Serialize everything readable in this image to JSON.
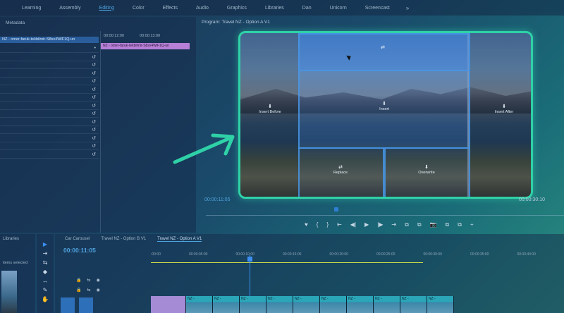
{
  "workspace_tabs": [
    "Learning",
    "Assembly",
    "Editing",
    "Color",
    "Effects",
    "Audio",
    "Graphics",
    "Libraries",
    "Dan",
    "Unicorn",
    "Screencast"
  ],
  "active_tab": "Editing",
  "more_glyph": "»",
  "metadata": {
    "title": "Metadata",
    "selected_row": "NZ - omer-faruk-tekbilmir-S8sx4WlF1Q-un",
    "clip_label": "NZ - omer-faruk-tekbilmir-S8sx4WlF1Q-un",
    "ruler": [
      "00:00:12:00",
      "00:00:13:00"
    ]
  },
  "program": {
    "title": "Program: Travel NZ - Option A V1",
    "overlay_labels": {
      "insert_before": "Insert Before",
      "insert": "Insert",
      "insert_after": "Insert After",
      "replace": "Replace",
      "overwrite": "Overwrite"
    },
    "timecode_left": "00:00:11:05",
    "timecode_right": "00:00:30:10",
    "transport": [
      "♥",
      "{",
      "}",
      "⇤",
      "◀|",
      "▶",
      "|▶",
      "⇥",
      "⧉",
      "⧉",
      "📷",
      "⧉",
      "⧉",
      "+"
    ]
  },
  "libraries": {
    "title": "Libraries",
    "status": "items selected"
  },
  "tools": [
    "▶",
    "⇥",
    "⇆",
    "◆",
    "↔",
    "✎",
    "✋"
  ],
  "sequence": {
    "tabs": [
      "Car Carousel",
      "Travel NZ - Option B V1",
      "Travel NZ - Option A V1"
    ],
    "active_tab": "Travel NZ - Option A V1",
    "timecode": "00:00:11:05",
    "ruler": [
      ":00:00",
      "00:00:05:00",
      "00:00:10:00",
      "00:00:15:00",
      "00:00:20:00",
      "00:00:25:00",
      "00:00:30:00",
      "00:00:35:00",
      "00:00:40:00"
    ],
    "clip_label": "NZ -",
    "clip_count": 10
  },
  "colors": {
    "accent": "#2fd1a7",
    "timecode": "#4fa3e0",
    "clip_purple": "#a58ad6",
    "clip_teal": "#2aa6b8"
  }
}
